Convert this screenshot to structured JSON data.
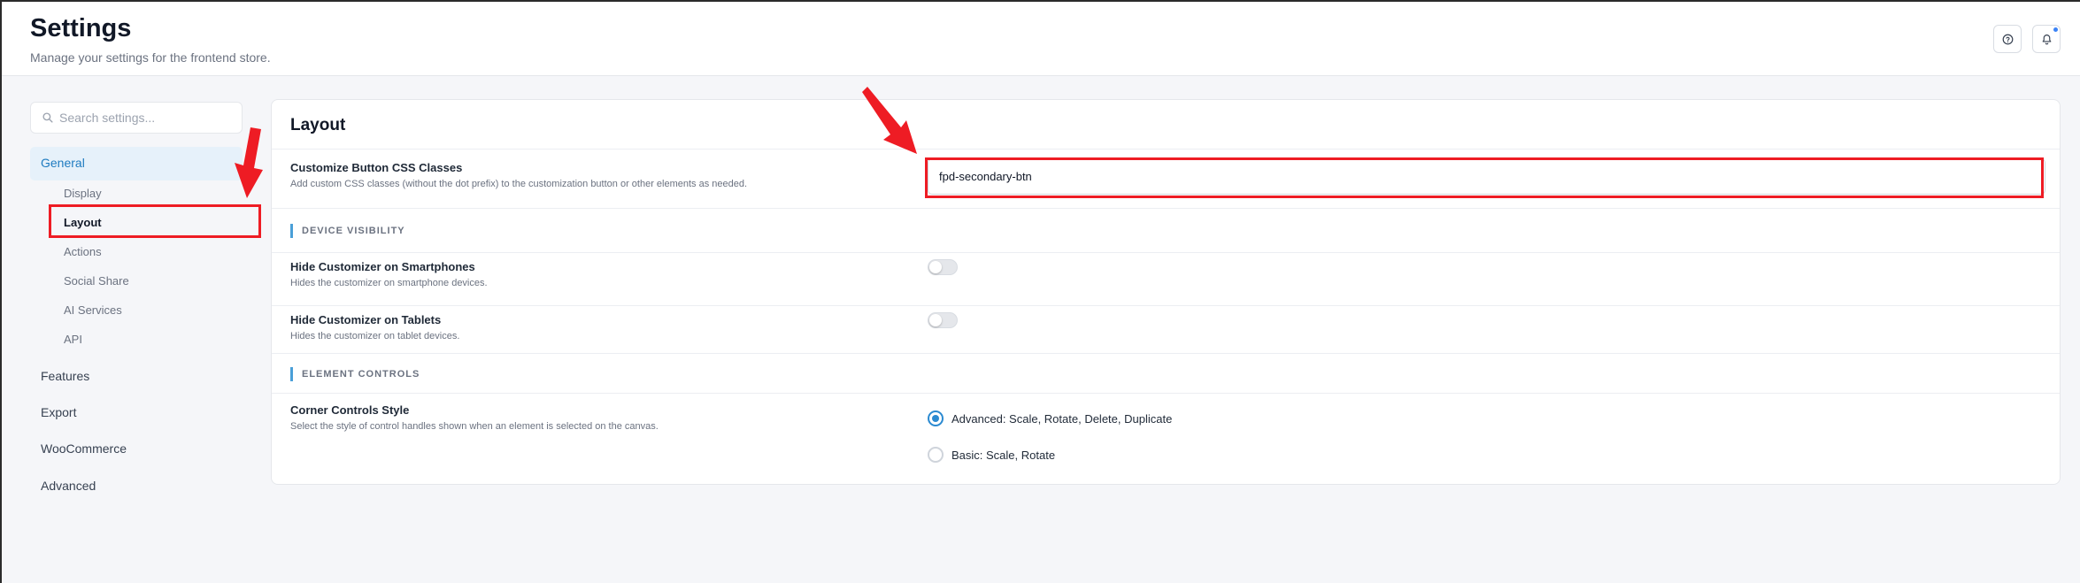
{
  "header": {
    "title": "Settings",
    "subtitle": "Manage your settings for the frontend store."
  },
  "sidebar": {
    "search_placeholder": "Search settings...",
    "general_label": "General",
    "sub_items": [
      "Display",
      "Layout",
      "Actions",
      "Social Share",
      "AI Services",
      "API"
    ],
    "active_sub_item": "Layout",
    "top_items": [
      "Features",
      "Export",
      "WooCommerce",
      "Advanced"
    ]
  },
  "main": {
    "title": "Layout",
    "css_classes": {
      "label": "Customize Button CSS Classes",
      "description": "Add custom CSS classes (without the dot prefix) to the customization button or other elements as needed.",
      "value": "fpd-secondary-btn"
    },
    "device_visibility": {
      "heading": "DEVICE VISIBILITY",
      "smartphones": {
        "label": "Hide Customizer on Smartphones",
        "description": "Hides the customizer on smartphone devices.",
        "enabled": false
      },
      "tablets": {
        "label": "Hide Customizer on Tablets",
        "description": "Hides the customizer on tablet devices.",
        "enabled": false
      }
    },
    "element_controls": {
      "heading": "ELEMENT CONTROLS",
      "corner_style": {
        "label": "Corner Controls Style",
        "description": "Select the style of control handles shown when an element is selected on the canvas.",
        "options": [
          "Advanced: Scale, Rotate, Delete, Duplicate",
          "Basic: Scale, Rotate"
        ],
        "selected": "Advanced: Scale, Rotate, Delete, Duplicate"
      }
    }
  },
  "colors": {
    "accent": "#2b8ad1",
    "annotation": "#ee1c24"
  }
}
